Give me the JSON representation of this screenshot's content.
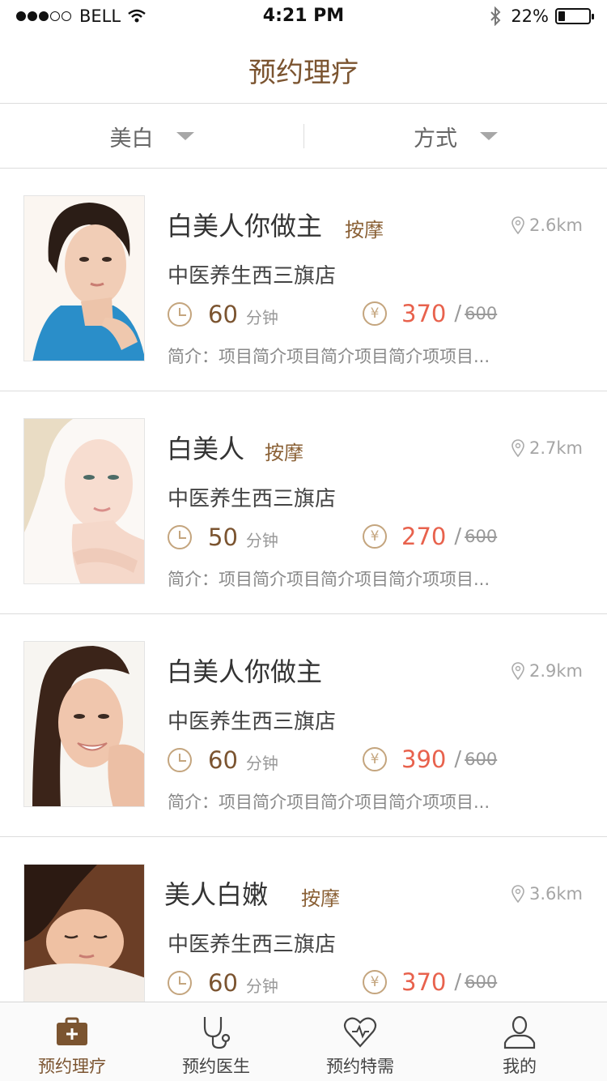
{
  "status_bar": {
    "carrier": "BELL",
    "time": "4:21 PM",
    "battery_text": "22%",
    "battery_level": 0.22,
    "signal_bars": 3
  },
  "nav": {
    "title": "预约理疗"
  },
  "filters": [
    {
      "label": "美白"
    },
    {
      "label": "方式"
    }
  ],
  "list": [
    {
      "title": "白美人你做主",
      "tag": "按摩",
      "distance": "2.6km",
      "store": "中医养生西三旗店",
      "minutes": "60",
      "minute_unit": "分钟",
      "price": "370",
      "slash": "/",
      "old_price": "600",
      "description": "简介：项目简介项目简介项目简介项项目..."
    },
    {
      "title": "白美人",
      "tag": "按摩",
      "distance": "2.7km",
      "store": "中医养生西三旗店",
      "minutes": "50",
      "minute_unit": "分钟",
      "price": "270",
      "slash": "/",
      "old_price": "600",
      "description": "简介：项目简介项目简介项目简介项项目..."
    },
    {
      "title": "白美人你做主",
      "tag": "",
      "distance": "2.9km",
      "store": "中医养生西三旗店",
      "minutes": "60",
      "minute_unit": "分钟",
      "price": "390",
      "slash": "/",
      "old_price": "600",
      "description": "简介：项目简介项目简介项目简介项项目..."
    },
    {
      "title": "美人白嫩",
      "tag": "按摩",
      "distance": "3.6km",
      "store": "中医养生西三旗店",
      "minutes": "60",
      "minute_unit": "分钟",
      "price": "370",
      "slash": "/",
      "old_price": "600",
      "description": ""
    }
  ],
  "tabs": [
    {
      "label": "预约理疗",
      "icon": "medical-kit-icon",
      "active": true
    },
    {
      "label": "预约医生",
      "icon": "stethoscope-icon",
      "active": false
    },
    {
      "label": "预约特需",
      "icon": "heart-icon",
      "active": false
    },
    {
      "label": "我的",
      "icon": "person-icon",
      "active": false
    }
  ],
  "colors": {
    "brand": "#7b5430",
    "price": "#e8624d",
    "accent_icon": "#c4a57e",
    "divider": "#dcdcdc"
  }
}
